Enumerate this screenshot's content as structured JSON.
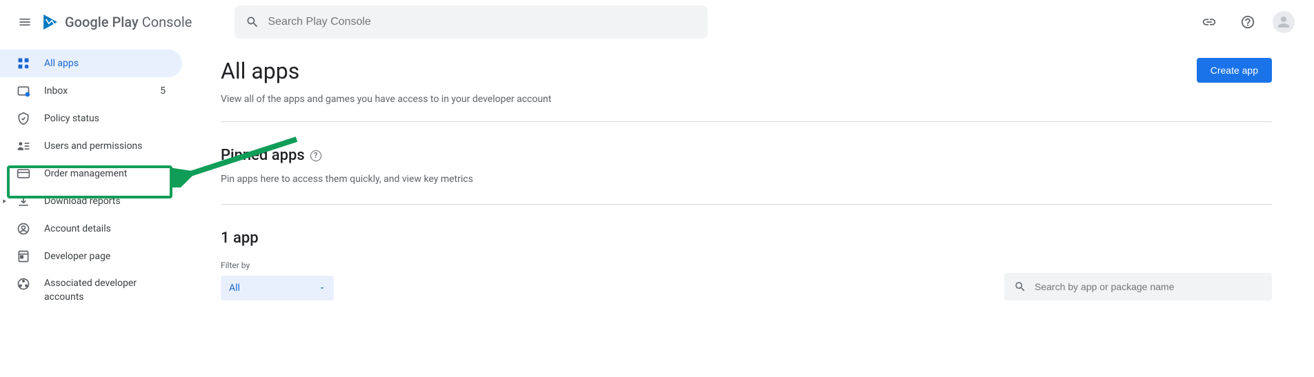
{
  "header": {
    "brand_primary": "Google Play",
    "brand_secondary": "Console",
    "search_placeholder": "Search Play Console"
  },
  "sidebar": {
    "items": [
      {
        "label": "All apps",
        "badge": ""
      },
      {
        "label": "Inbox",
        "badge": "5"
      },
      {
        "label": "Policy status",
        "badge": ""
      },
      {
        "label": "Users and permissions",
        "badge": ""
      },
      {
        "label": "Order management",
        "badge": ""
      },
      {
        "label": "Download reports",
        "badge": ""
      },
      {
        "label": "Account details",
        "badge": ""
      },
      {
        "label": "Developer page",
        "badge": ""
      },
      {
        "label": "Associated developer accounts",
        "badge": ""
      }
    ]
  },
  "main": {
    "title": "All apps",
    "subtitle": "View all of the apps and games you have access to in your developer account",
    "create_button": "Create app",
    "pinned": {
      "title": "Pinned apps",
      "subtitle": "Pin apps here to access them quickly, and view key metrics"
    },
    "apps": {
      "title": "1 app",
      "filter_label": "Filter by",
      "filter_value": "All",
      "search_placeholder": "Search by app or package name"
    }
  }
}
